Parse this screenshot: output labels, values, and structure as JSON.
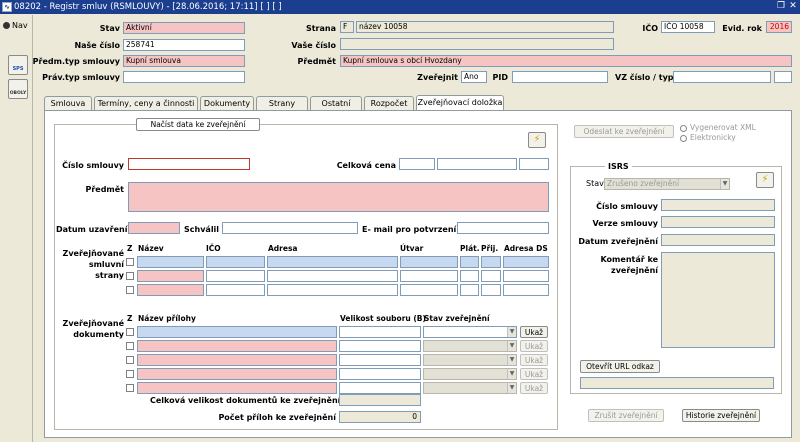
{
  "window": {
    "title": "08202 - Registr smluv (RSMLOUVY) - [28.06.2016; 17:11] [ ] [ ]",
    "restore_glyph": "❐",
    "close_glyph": "✕",
    "app_icon": "app-icon"
  },
  "sidebar": {
    "nav_label": "Nav",
    "btn1": "SPS",
    "btn2": "OBOLY"
  },
  "header": {
    "stav_label": "Stav",
    "stav_value": "Aktivní",
    "strana_label": "Strana",
    "strana_code": "F",
    "strana_name": "název 10058",
    "ico_label": "IČO",
    "ico_value": "IČO 10058",
    "evid_rok_label": "Evid. rok",
    "evid_rok_value": "2016",
    "nase_cislo_label": "Naše číslo",
    "nase_cislo_value": "258741",
    "vase_cislo_label": "Vaše číslo",
    "vase_cislo_value": "",
    "predm_typ_label": "Předm.typ smlouvy",
    "predm_typ_value": "Kupní smlouva",
    "predmet_label": "Předmět",
    "predmet_value": "Kupní smlouva s obcí Hvozdany",
    "prav_typ_label": "Práv.typ smlouvy",
    "prav_typ_value": "",
    "zverejnit_label": "Zveřejnit",
    "zverejnit_value": "Ano",
    "pid_label": "PID",
    "pid_value": "",
    "vz_label": "VZ číslo / typ",
    "vz_value": ""
  },
  "tabs": [
    "Smlouva",
    "Termíny, ceny a činnosti",
    "Dokumenty",
    "Strany",
    "Ostatní",
    "Rozpočet",
    "Zveřejňovací doložka"
  ],
  "main": {
    "load_btn": "Načíst data ke zveřejnění",
    "cislo_smlouvy_label": "Číslo smlouvy",
    "cislo_smlouvy_value": "",
    "celkova_cena_label": "Celková cena",
    "predmet_label": "Předmět",
    "predmet_value": "",
    "datum_uzavreni_label": "Datum uzavření",
    "schvalil_label": "Schválil",
    "email_label": "E- mail pro potvrzení",
    "strany_label": "Zveřejňované smluvní strany",
    "strany_cols": [
      "Z",
      "Název",
      "IČO",
      "Adresa",
      "Útvar",
      "Plát.",
      "Přij.",
      "Adresa DS"
    ],
    "prilohy_label": "Zveřejňované dokumenty",
    "prilohy_cols": [
      "Z",
      "Název přílohy",
      "Velikost souboru (B)",
      "Stav zveřejnění"
    ],
    "ukaz": "Ukaž",
    "celk_velikost_label": "Celková velikost dokumentů ke zveřejnění",
    "pocet_priloh_label": "Počet příloh ke zveřejnění",
    "pocet_priloh_value": "0"
  },
  "right": {
    "odeslat_btn": "Odeslat ke zveřejnění",
    "radio1": "Vygenerovat XML",
    "radio2": "Elektronicky",
    "isrs_title": "ISRS",
    "stav_label": "Stav",
    "stav_value": "Zrušeno zveřejnění",
    "cislo_label": "Číslo smlouvy",
    "verze_label": "Verze smlouvy",
    "datum_label": "Datum zveřejnění",
    "komentar_label": "Komentář ke zveřejnění",
    "url_btn": "Otevřít URL odkaz",
    "zrusit_btn": "Zrušit zveřejnění",
    "historie_btn": "Historie zveřejnění"
  }
}
